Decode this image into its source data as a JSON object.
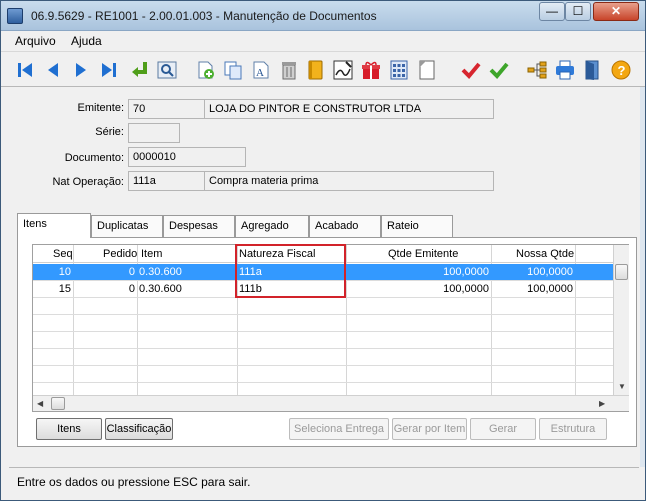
{
  "window": {
    "title": "06.9.5629 - RE1001 - 2.00.01.003 - Manutenção de Documentos",
    "minimize_label": "—",
    "maximize_label": "☐",
    "close_label": "✕"
  },
  "menu": {
    "items": [
      "Arquivo",
      "Ajuda"
    ]
  },
  "toolbar": {
    "icons": [
      "first-icon",
      "previous-icon",
      "next-icon",
      "last-icon",
      "goto-icon",
      "search-icon",
      "new-icon",
      "copy-icon",
      "edit-icon",
      "delete-icon",
      "book-icon",
      "signature-icon",
      "gift-icon",
      "calculator-icon",
      "page-icon",
      "confirm-icon",
      "confirm-all-icon",
      "tree-icon",
      "print-icon",
      "exit-icon",
      "help-icon"
    ]
  },
  "form": {
    "emitente_label": "Emitente:",
    "emitente_code": "70",
    "emitente_name": "LOJA DO PINTOR E CONSTRUTOR LTDA",
    "serie_label": "Série:",
    "serie_value": "",
    "documento_label": "Documento:",
    "documento_value": "0000010",
    "nat_operacao_label": "Nat Operação:",
    "nat_operacao_code": "111a",
    "nat_operacao_desc": "Compra materia prima"
  },
  "tabs": [
    "Itens",
    "Duplicatas",
    "Despesas",
    "Agregado",
    "Acabado",
    "Rateio"
  ],
  "grid": {
    "columns": [
      "Seq",
      "Pedido",
      "Item",
      "Natureza Fiscal",
      "Qtde Emitente",
      "Nossa Qtde"
    ],
    "rows": [
      {
        "seq": "10",
        "pedido": "0",
        "item": "0.30.600",
        "natureza": "111a",
        "qtde_emitente": "100,0000",
        "nossa_qtde": "100,0000"
      },
      {
        "seq": "15",
        "pedido": "0",
        "item": "0.30.600",
        "natureza": "111b",
        "qtde_emitente": "100,0000",
        "nossa_qtde": "100,0000"
      }
    ]
  },
  "buttons": {
    "itens": "Itens",
    "classificacao": "Classificação",
    "seleciona_entrega": "Seleciona Entrega",
    "gerar_por_item": "Gerar por Item",
    "gerar": "Gerar",
    "estrutura": "Estrutura"
  },
  "status": "Entre os dados ou pressione ESC para sair."
}
